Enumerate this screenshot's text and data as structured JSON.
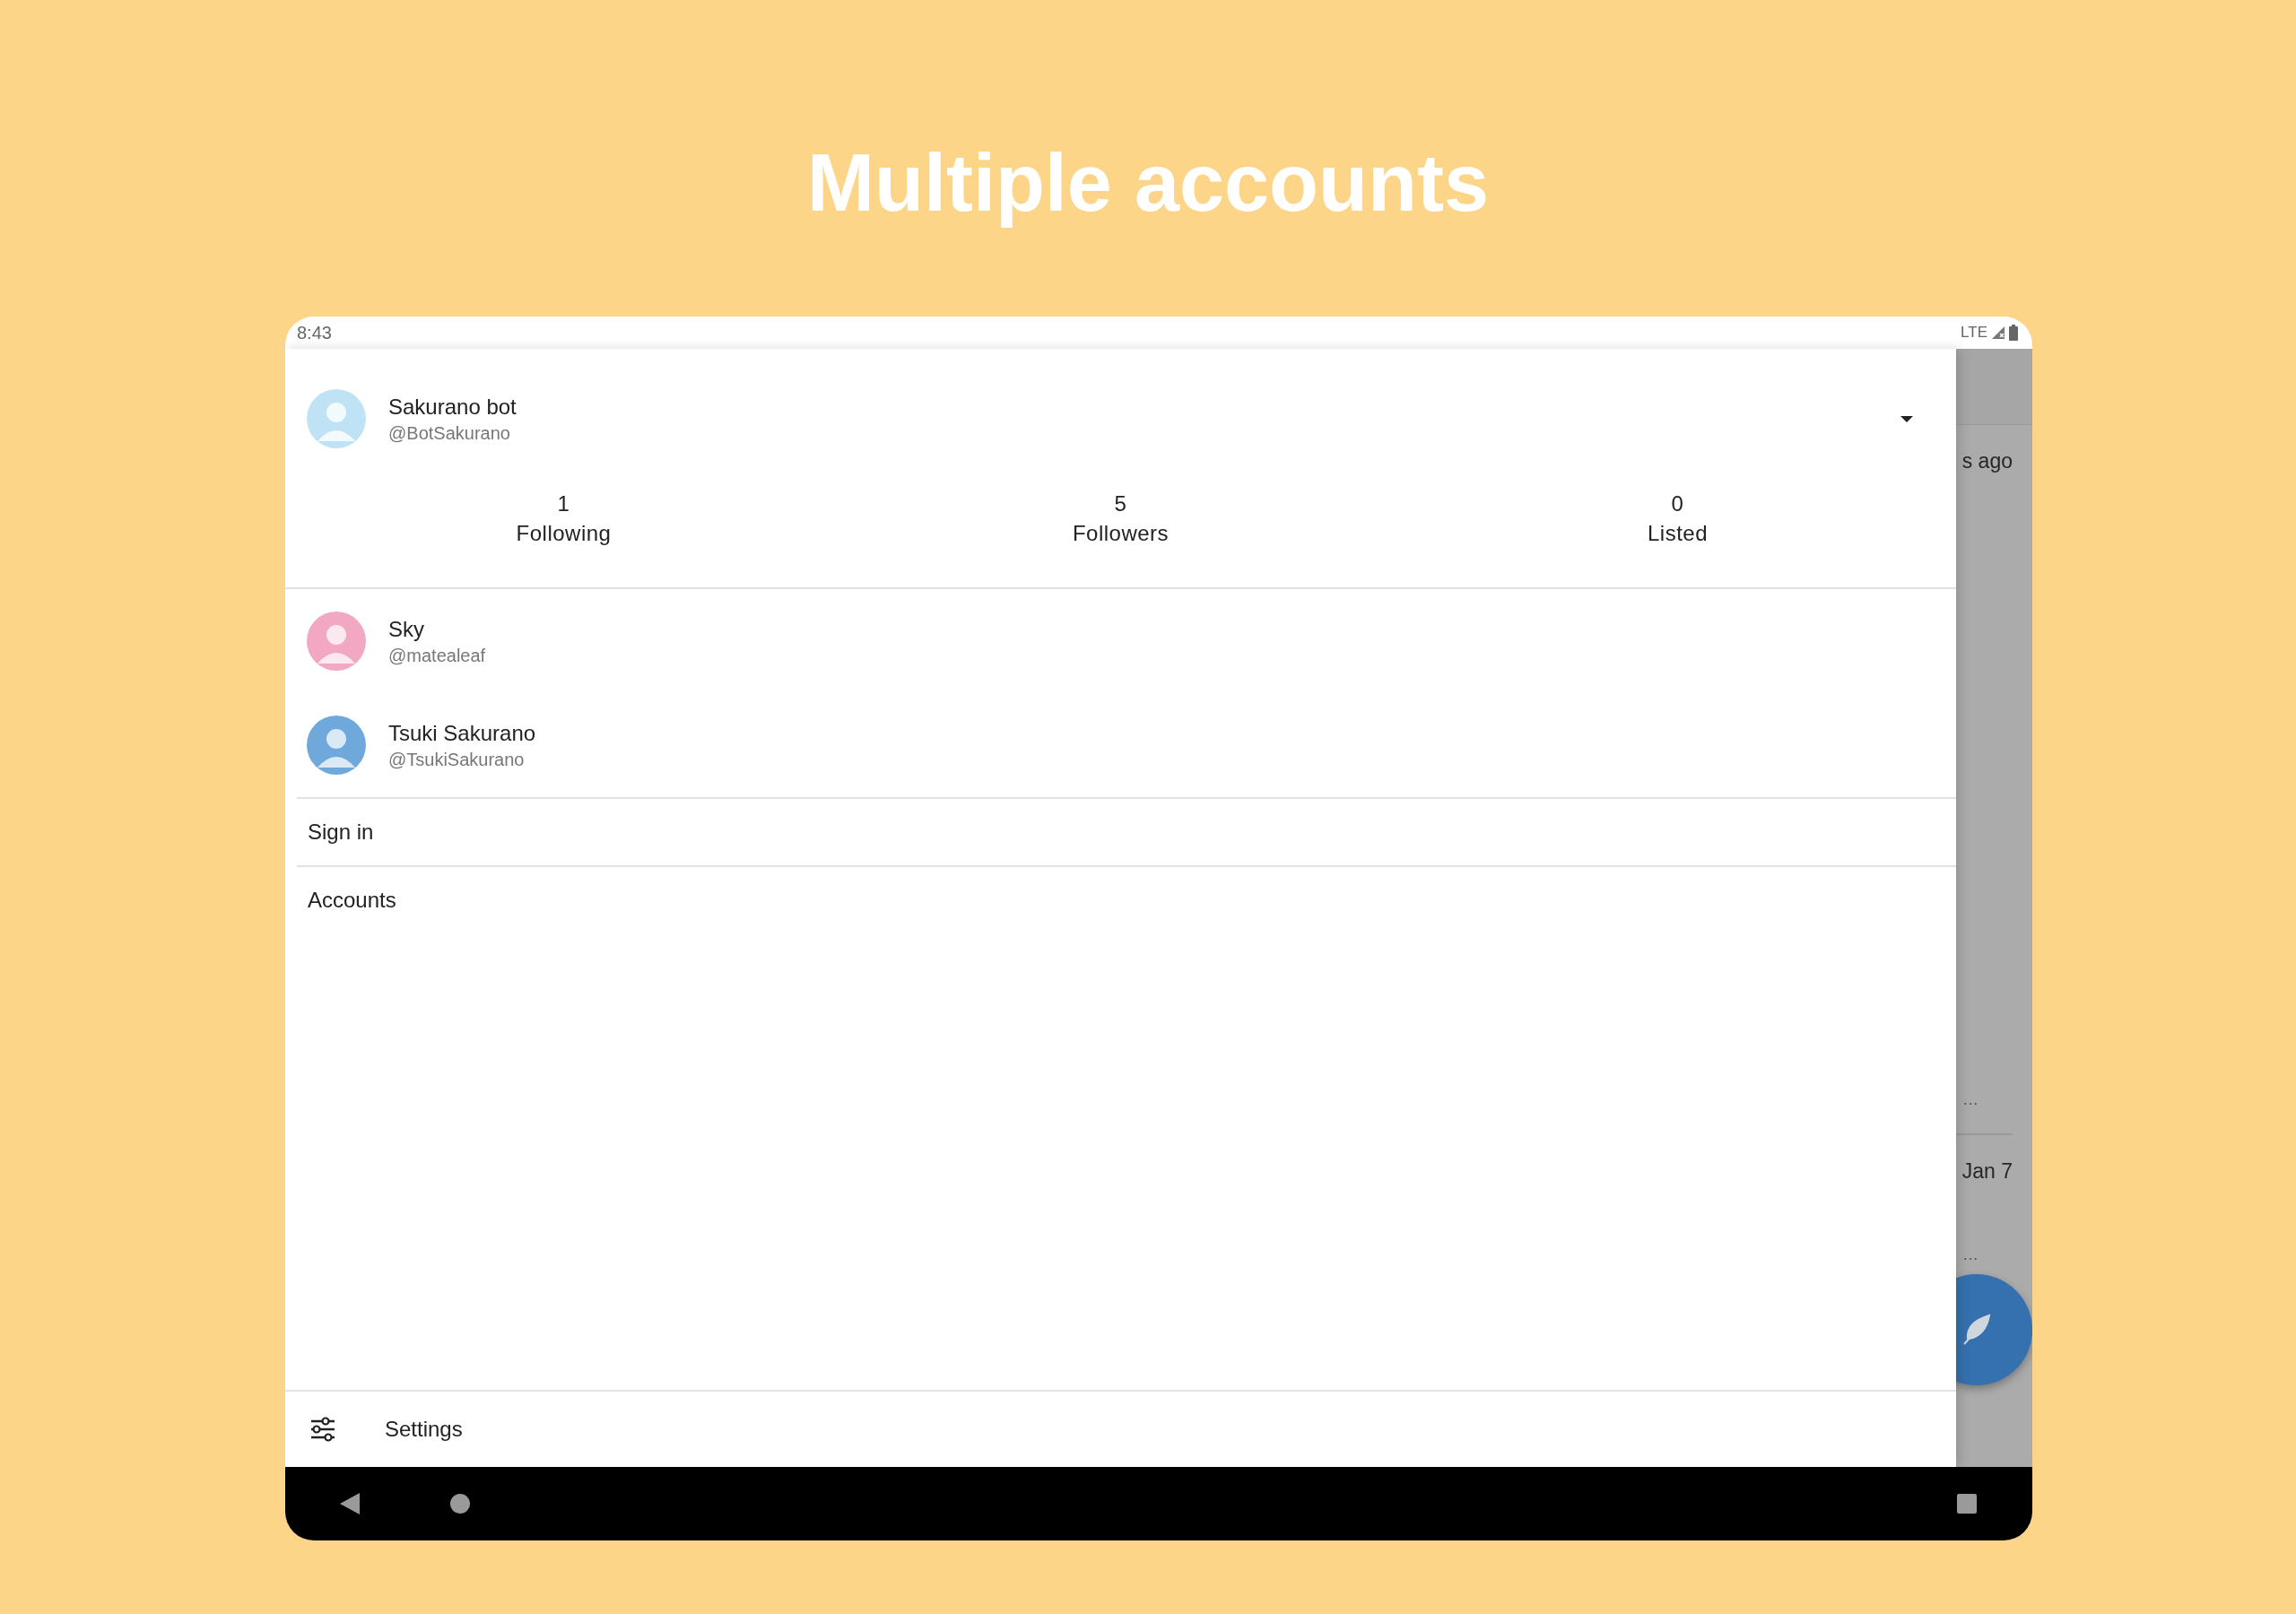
{
  "title": "Multiple accounts",
  "status_bar": {
    "time": "8:43",
    "network": "LTE"
  },
  "drawer": {
    "current_account": {
      "name": "Sakurano bot",
      "handle": "@BotSakurano"
    },
    "stats": [
      {
        "value": "1",
        "label": "Following"
      },
      {
        "value": "5",
        "label": "Followers"
      },
      {
        "value": "0",
        "label": "Listed"
      }
    ],
    "accounts": [
      {
        "name": "Sky",
        "handle": "@matealeaf"
      },
      {
        "name": "Tsuki Sakurano",
        "handle": "@TsukiSakurano"
      }
    ],
    "menu": [
      "Sign in",
      "Accounts"
    ],
    "settings": "Settings"
  },
  "background_timeline": [
    {
      "kind": "time",
      "text": "s ago"
    },
    {
      "kind": "more",
      "text": "…"
    },
    {
      "kind": "time",
      "text": "Jan 7"
    },
    {
      "kind": "more",
      "text": "…"
    }
  ]
}
